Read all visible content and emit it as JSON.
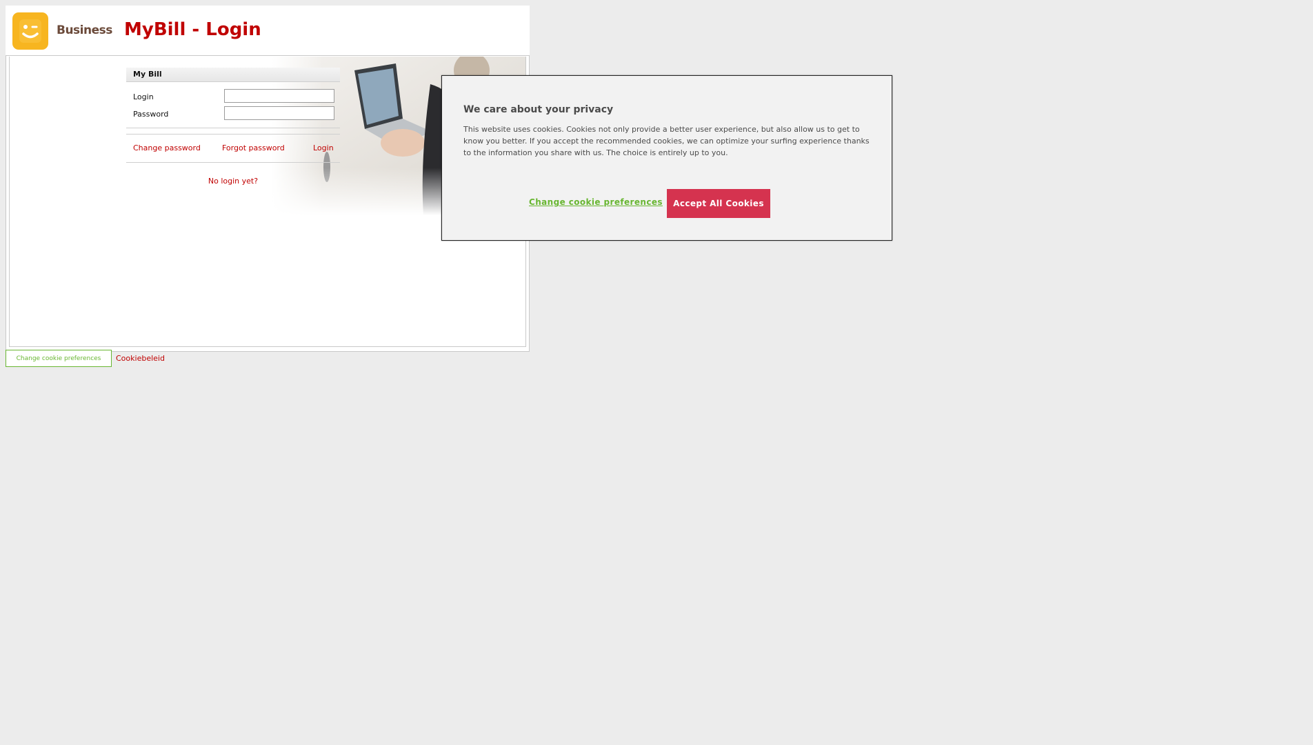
{
  "header": {
    "logo_text": "Business",
    "title": "MyBill - Login"
  },
  "login_panel": {
    "heading": "My Bill",
    "login_label": "Login",
    "login_value": "",
    "password_label": "Password",
    "password_value": "",
    "change_password": "Change password",
    "forgot_password": "Forgot password",
    "login_button": "Login",
    "no_login": "No login yet?"
  },
  "footer": {
    "change_prefs": "Change cookie preferences",
    "cookie_policy": "Cookiebeleid"
  },
  "cookie_dialog": {
    "title": "We care about your privacy",
    "body": "This website uses cookies. Cookies not only provide a better user experience, but also allow us to get to know you better. If you accept the recommended cookies, we can optimize your surfing experience thanks to the information you share with us. The choice is entirely up to you.",
    "change_prefs": "Change cookie preferences",
    "accept_all": "Accept All Cookies"
  },
  "colors": {
    "brand_red": "#c00000",
    "logo_yellow": "#f7b520",
    "accept_button": "#d5334f",
    "link_green": "#68b631"
  }
}
